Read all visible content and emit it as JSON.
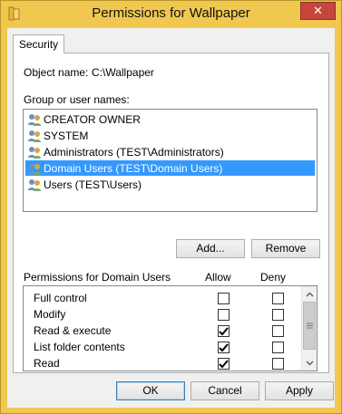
{
  "window": {
    "title": "Permissions for Wallpaper",
    "icon": "folder-icon",
    "close_glyph": "✕"
  },
  "tabs": [
    {
      "label": "Security",
      "selected": true
    }
  ],
  "object": {
    "label": "Object name:",
    "value": "C:\\Wallpaper"
  },
  "groups": {
    "label": "Group or user names:",
    "items": [
      {
        "name": "CREATOR OWNER",
        "icon": "users-icon",
        "selected": false
      },
      {
        "name": "SYSTEM",
        "icon": "users-icon",
        "selected": false
      },
      {
        "name": "Administrators (TEST\\Administrators)",
        "icon": "users-icon",
        "selected": false
      },
      {
        "name": "Domain Users (TEST\\Domain Users)",
        "icon": "users-icon",
        "selected": true
      },
      {
        "name": "Users (TEST\\Users)",
        "icon": "users-icon",
        "selected": false
      }
    ],
    "add_label": "Add...",
    "remove_label": "Remove"
  },
  "permissions": {
    "label": "Permissions for Domain Users",
    "allow_header": "Allow",
    "deny_header": "Deny",
    "rows": [
      {
        "name": "Full control",
        "allow": false,
        "deny": false
      },
      {
        "name": "Modify",
        "allow": false,
        "deny": false
      },
      {
        "name": "Read & execute",
        "allow": true,
        "deny": false
      },
      {
        "name": "List folder contents",
        "allow": true,
        "deny": false
      },
      {
        "name": "Read",
        "allow": true,
        "deny": false
      }
    ]
  },
  "footer": {
    "ok_label": "OK",
    "cancel_label": "Cancel",
    "apply_label": "Apply"
  },
  "colors": {
    "titlebar": "#f0c850",
    "selection": "#3399ff",
    "close_button": "#c7463a"
  }
}
